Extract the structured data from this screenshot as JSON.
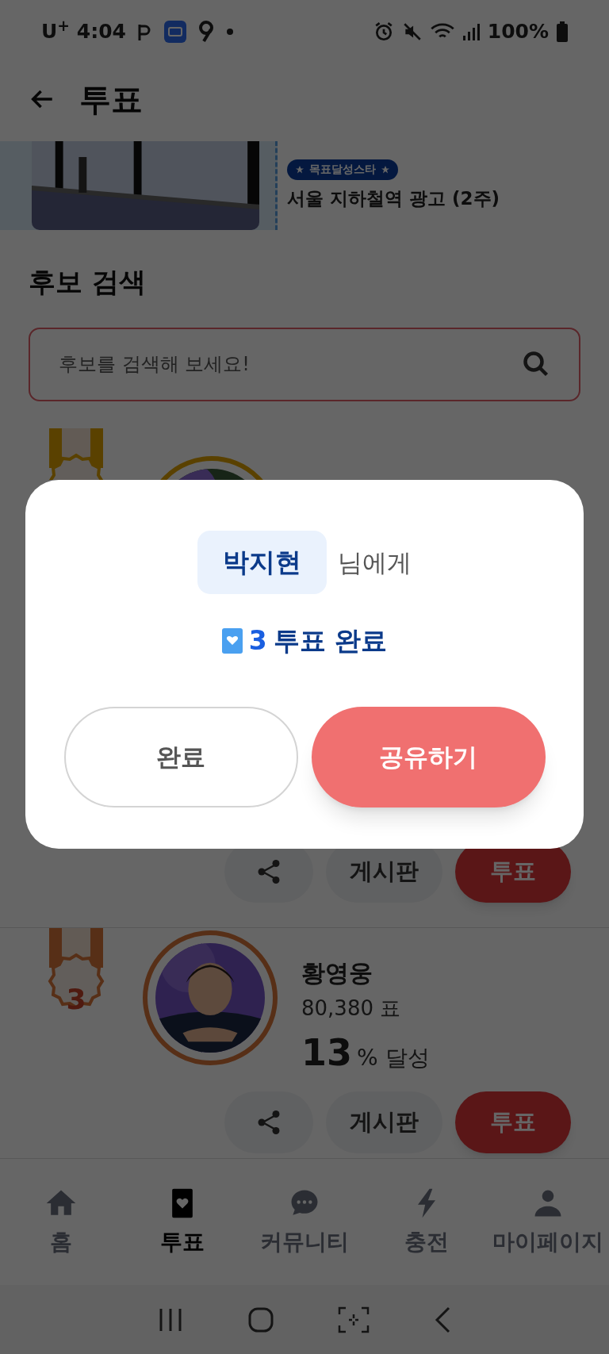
{
  "status_bar": {
    "carrier": "U$^{+}$",
    "time": "4:04",
    "battery": "100%"
  },
  "header": {
    "title": "투표"
  },
  "banner": {
    "badge": "목표달성스타",
    "title": "서울 지하철역 광고 (2주)"
  },
  "search": {
    "heading": "후보 검색",
    "placeholder": "후보를 검색해 보세요!"
  },
  "ranking": [
    {
      "kind": "top"
    },
    {
      "kind": "actions",
      "board": "게시판",
      "vote": "투표"
    },
    {
      "kind": "full",
      "rank": "3",
      "name": "황영웅",
      "votes": "80,380 표",
      "percent": "13",
      "percent_suffix": "% 달성",
      "board": "게시판",
      "vote": "투표"
    }
  ],
  "modal": {
    "recipient": "박지현",
    "suffix": "님에게",
    "count": "3",
    "message": "투표 완료",
    "buttons": [
      {
        "label": "완료",
        "kind": "secondary"
      },
      {
        "label": "공유하기",
        "kind": "primary"
      }
    ]
  },
  "nav": [
    {
      "label": "홈",
      "selected": false
    },
    {
      "label": "투표",
      "selected": true
    },
    {
      "label": "커뮤니티",
      "selected": false
    },
    {
      "label": "충전",
      "selected": false
    },
    {
      "label": "마이페이지",
      "selected": false
    }
  ]
}
